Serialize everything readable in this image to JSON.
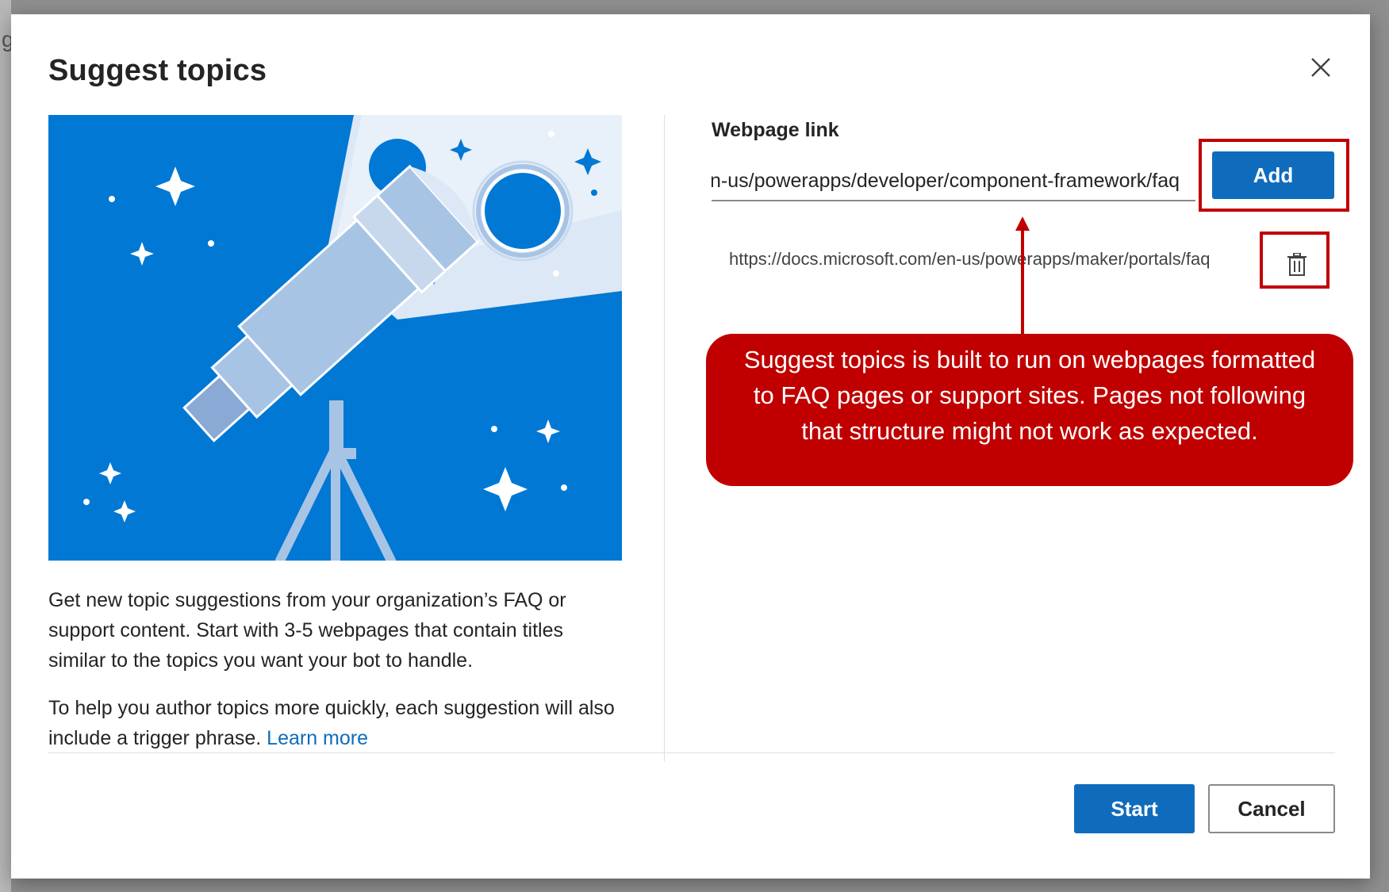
{
  "dialog": {
    "title": "Suggest topics",
    "close_label": "Close"
  },
  "background": {
    "partial_letter": "g"
  },
  "illustration": {
    "subject": "telescope-under-starry-sky",
    "colors": {
      "sky": "#0078d4",
      "beam": "#dbe9f6",
      "telescope": "#a8c4e5",
      "moon": "#0078d4"
    }
  },
  "description": {
    "paragraph1": "Get new topic suggestions from your organization’s FAQ or support content. Start with 3-5 webpages that contain titles similar to the topics you want your bot to handle.",
    "paragraph2_text": "To help you author topics more quickly, each suggestion will also include a trigger phrase.",
    "learn_more": "Learn more"
  },
  "form": {
    "field_label": "Webpage link",
    "input_value": "https://docs.microsoft.com/en-us/powerapps/developer/component-framework/faq",
    "add_label": "Add",
    "added_links": [
      {
        "url": "https://docs.microsoft.com/en-us/powerapps/maker/portals/faq",
        "delete_icon": "trash-icon"
      }
    ]
  },
  "annotation": {
    "callout_text": "Suggest topics is built to run on webpages formatted to FAQ pages or support sites. Pages not following that structure might not work as expected.",
    "highlight_color": "#c00000"
  },
  "footer": {
    "start_label": "Start",
    "cancel_label": "Cancel"
  },
  "colors": {
    "primary": "#0f6cbd",
    "text": "#242424",
    "link": "#0f6cbd"
  }
}
